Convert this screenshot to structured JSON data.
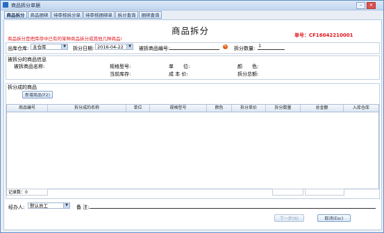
{
  "window": {
    "title": "商品拆分单据"
  },
  "tabs": [
    {
      "label": "商品拆分"
    },
    {
      "label": "商品捆绑"
    },
    {
      "label": "待审核拆分单"
    },
    {
      "label": "待审核捆绑单"
    },
    {
      "label": "拆分查询"
    },
    {
      "label": "捆绑查询"
    }
  ],
  "header": {
    "title": "商品拆分",
    "notice": "商品拆分是把库存中已有的某种商品拆分成其他几种商品!",
    "order_no": "单号：CF16042210001"
  },
  "form": {
    "warehouse_label": "出库仓库:",
    "warehouse_value": "主仓库",
    "date_label": "拆分日期:",
    "date_value": "2016-04-22",
    "product_code_label": "被拆商品编号:",
    "product_code_value": "",
    "qty_label": "拆分数量:",
    "qty_value": "1"
  },
  "split_info": {
    "section_title": "被拆分的商品信息",
    "name_label": "被拆商品名称:",
    "spec_label": "规格型号:",
    "unit_label": "单　　位:",
    "color_label": "颜　　色:",
    "stock_label": "当前库存:",
    "cost_label": "成 本 价:",
    "total_label": "拆分总额:"
  },
  "items_group": {
    "title": "拆分成的商品",
    "add_button": "新增商品(F2)",
    "columns": [
      "商品编号",
      "拆分成的名称",
      "单位",
      "规格型号",
      "颜色",
      "拆分单价",
      "拆分数量",
      "总金额",
      "入库仓库"
    ],
    "record_label": "记录数：",
    "record_count": "0"
  },
  "footer": {
    "handler_label": "经办人:",
    "handler_value": "默认员工",
    "remark_label": "备 注:",
    "remark_value": "",
    "next_button": "下一步(N)",
    "cancel_button": "取消(Esc)"
  }
}
